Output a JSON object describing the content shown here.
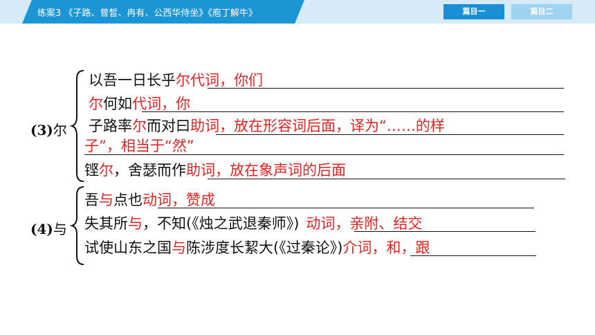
{
  "header": {
    "title": "练案3 《子路、曾皙、冉有、公西华侍坐》《庖丁解牛》",
    "tab1": "篇目一",
    "tab2": "篇目二"
  },
  "sections": [
    {
      "number": "(3)",
      "char": "尔",
      "items": [
        {
          "pre": "以吾一日长乎",
          "red": "尔",
          "post": "",
          "answer": "代词，你们"
        },
        {
          "pre": "",
          "red": "尔",
          "post": "何如",
          "answer": "代词，你"
        },
        {
          "pre": "子路率",
          "red": "尔",
          "post": "而对曰",
          "answer": "助词，放在形容词后面，译为“……的样",
          "answer2": "子”，相当于“然”"
        },
        {
          "pre": "铿",
          "red": "尔",
          "post": "，舍瑟而作",
          "answer": "助词，放在象声词的后面"
        }
      ]
    },
    {
      "number": "(4)",
      "char": "与",
      "items": [
        {
          "pre": "吾",
          "red": "与",
          "post": "点也",
          "answer": "动词，赞成"
        },
        {
          "pre": "失其所",
          "red": "与",
          "post": "，不知(《烛之武退秦师》)",
          "answer": "动词，亲附、结交"
        },
        {
          "pre": "试使山东之国",
          "red": "与",
          "post": "陈涉度长絜大(《过秦论》)",
          "answer": "介词，和，跟"
        }
      ]
    }
  ]
}
